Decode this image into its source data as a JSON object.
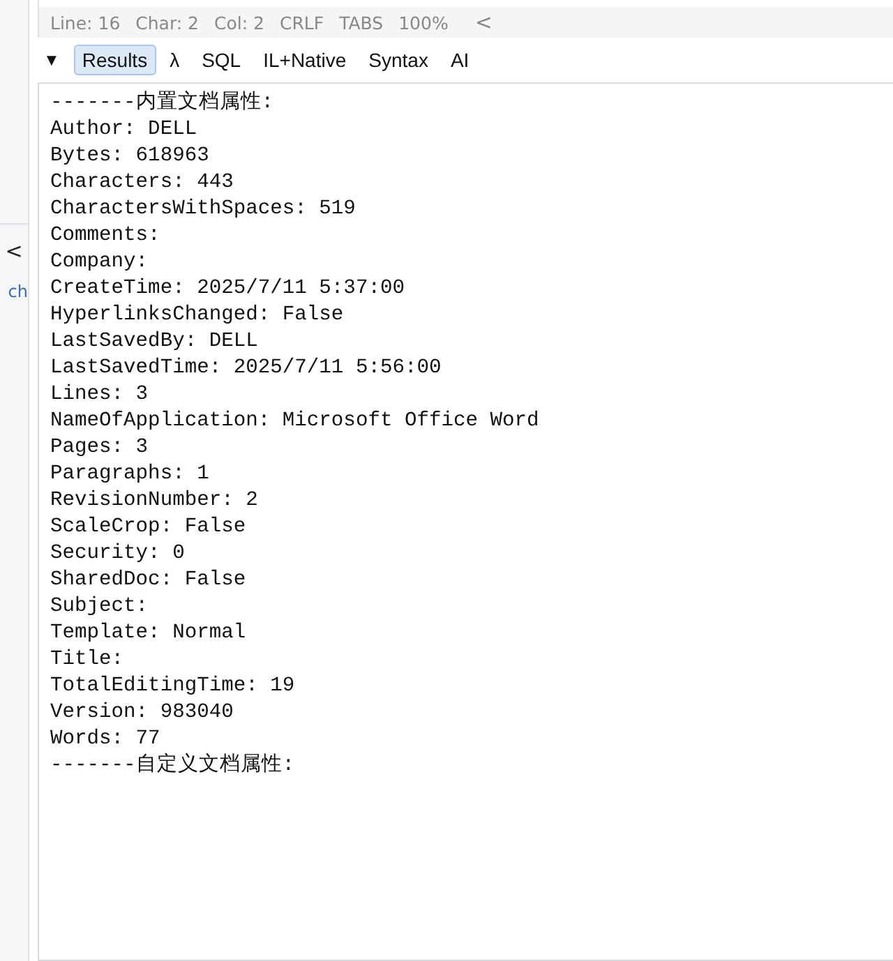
{
  "left_panel": {
    "collapse_button": "<",
    "cut_label": "ch"
  },
  "status_bar": {
    "items": [
      "Line: 16",
      "Char: 2",
      "Col: 2",
      "CRLF",
      "TABS",
      "100%"
    ],
    "collapse_button": "<"
  },
  "results_toolbar": {
    "toggle": "▼",
    "tabs": [
      {
        "label": "Results",
        "selected": true
      },
      {
        "label": "λ",
        "selected": false
      },
      {
        "label": "SQL",
        "selected": false
      },
      {
        "label": "IL+Native",
        "selected": false
      },
      {
        "label": "Syntax",
        "selected": false
      },
      {
        "label": "AI",
        "selected": false
      }
    ]
  },
  "output_lines": [
    "-------内置文档属性:",
    "Author: DELL",
    "Bytes: 618963",
    "Characters: 443",
    "CharactersWithSpaces: 519",
    "Comments:",
    "Company:",
    "CreateTime: 2025/7/11 5:37:00",
    "HyperlinksChanged: False",
    "LastSavedBy: DELL",
    "LastSavedTime: 2025/7/11 5:56:00",
    "Lines: 3",
    "NameOfApplication: Microsoft Office Word",
    "Pages: 3",
    "Paragraphs: 1",
    "RevisionNumber: 2",
    "ScaleCrop: False",
    "Security: 0",
    "SharedDoc: False",
    "Subject:",
    "Template: Normal",
    "Title:",
    "TotalEditingTime: 19",
    "Version: 983040",
    "Words: 77",
    "-------自定义文档属性:"
  ]
}
